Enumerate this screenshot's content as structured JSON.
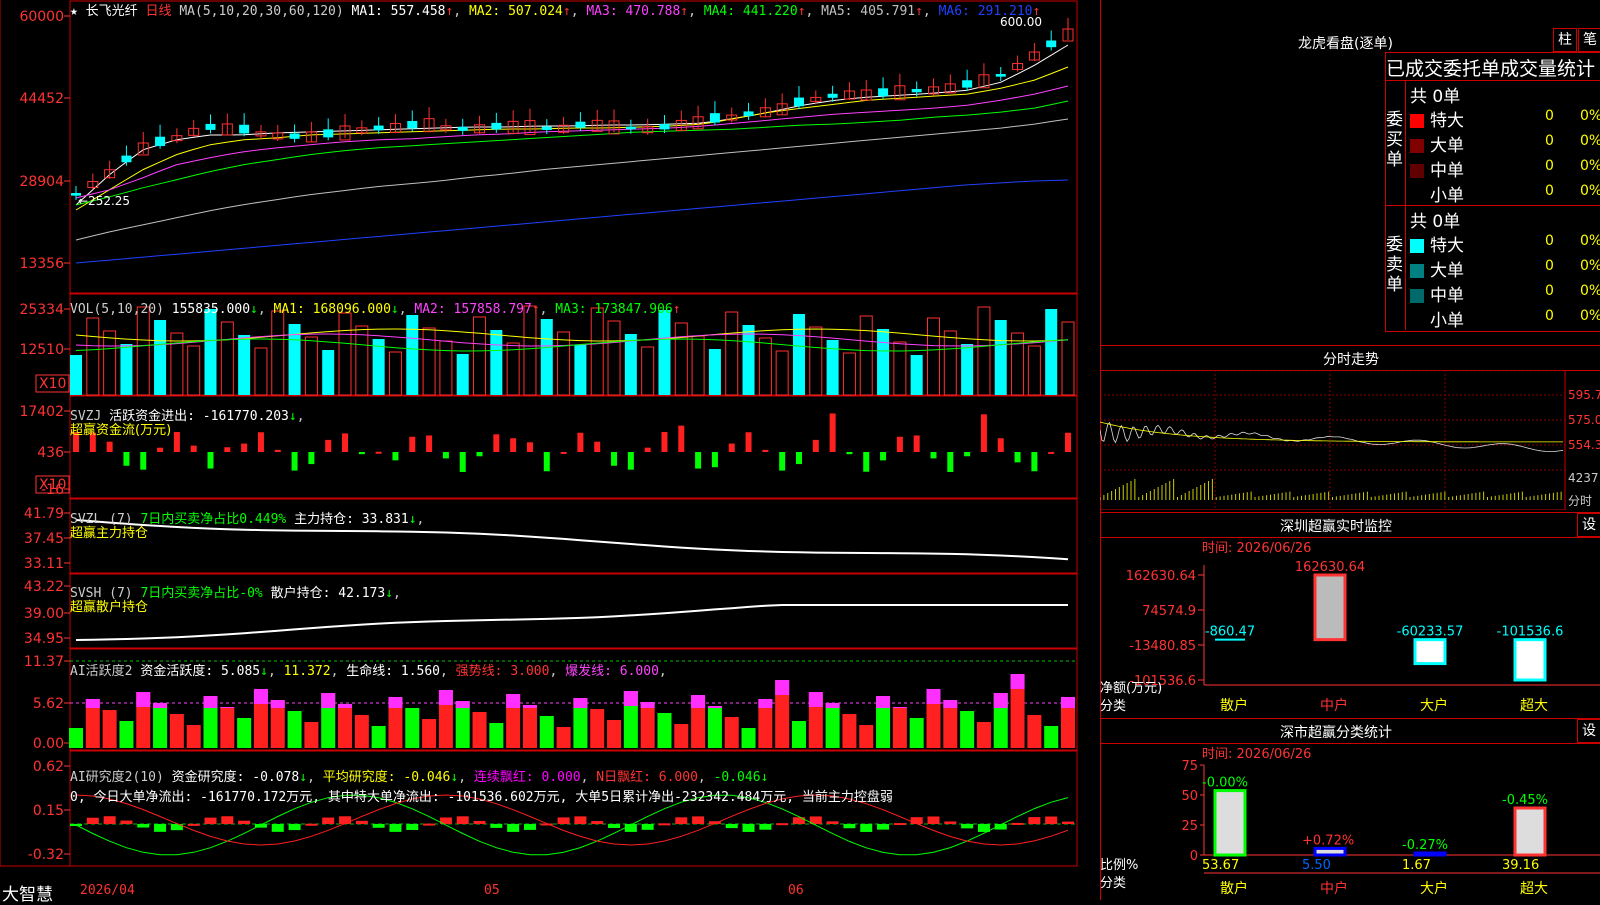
{
  "app": {
    "brand": "大智慧"
  },
  "stock": {
    "name": "长飞光纤",
    "period": "日线"
  },
  "main_panel": {
    "yticks": [
      "60000",
      "44452",
      "28904",
      "13356"
    ],
    "ma_prefix": "MA(5,10,20,30,60,120)",
    "ma": [
      {
        "label": "MA1: 557.458",
        "arrow": "↑",
        "color": "#ffffff"
      },
      {
        "label": "MA2: 507.024",
        "arrow": "↑",
        "color": "#ffff00"
      },
      {
        "label": "MA3: 470.788",
        "arrow": "↑",
        "color": "#ff40ff"
      },
      {
        "label": "MA4: 441.220",
        "arrow": "↑",
        "color": "#00ff00"
      },
      {
        "label": "MA5: 405.791",
        "arrow": "↑",
        "color": "#c0c0c0"
      },
      {
        "label": "MA6: 291.210",
        "arrow": "↑",
        "color": "#2040ff"
      }
    ],
    "high_label": "600.00",
    "low_label": "←252.25"
  },
  "vol_panel": {
    "title": "VOL(5,10,20)",
    "val": "155835.000",
    "val_arrow": "↓",
    "ma1": "MA1: 168096.000",
    "ma1_arrow": "↓",
    "ma2": "MA2: 157858.797",
    "ma2_arrow": "↑",
    "ma3": "MA3: 173847.906",
    "ma3_arrow": "↑",
    "yticks": [
      "25334",
      "12510"
    ],
    "unit": "X10"
  },
  "svzj": {
    "title": "SVZJ",
    "desc": "活跃资金进出: -161770.203",
    "desc_arrow": "↓",
    "subtitle": "超赢资金流(万元)",
    "yticks": [
      "17402",
      "436",
      "-16"
    ],
    "unit": "X10"
  },
  "svzl": {
    "title": "SVZL (7)",
    "desc": "7日内买卖净占比0.449%",
    "desc2": "主力持仓: 33.831",
    "arrow": "↓",
    "subtitle": "超赢主力持仓",
    "yticks": [
      "41.79",
      "37.45",
      "33.11"
    ]
  },
  "svsh": {
    "title": "SVSH (7)",
    "desc": "7日内买卖净占比-0%",
    "desc2": "散户持仓: 42.173",
    "arrow": "↓",
    "subtitle": "超赢散户持仓",
    "yticks": [
      "43.22",
      "39.00",
      "34.95"
    ]
  },
  "ai1": {
    "title": "AI活跃度2",
    "v1": "资金活跃度: 5.085",
    "v1_arrow": "↓",
    "v2": "11.372",
    "v3": "生命线: 1.560",
    "v4": "强势线: 3.000",
    "v5": "爆发线: 6.000",
    "yticks": [
      "11.37",
      "5.62",
      "0.00"
    ]
  },
  "ai2": {
    "title": "AI研究度2(10)",
    "v1": "资金研究度: -0.078",
    "v2": "平均研究度: -0.046",
    "v3": "连续飘红: 0.000",
    "v4": "N日飘红: 6.000",
    "v5": "-0.046",
    "arrow": "↓",
    "line2": "0, 今日大单净流出: -161770.172万元, 其中特大单净流出: -101536.602万元, 大单5日累计净出-232342.484万元, 当前主力控盘弱",
    "yticks": [
      "0.62",
      "0.15",
      "-0.32"
    ]
  },
  "xaxis": {
    "labels": [
      "2026/04",
      "05",
      "06"
    ]
  },
  "right": {
    "lhb_title": "龙虎看盘(逐单)",
    "btn1": "柱",
    "btn2": "笔",
    "header": "已成交委托单成交量统计",
    "buy": {
      "side_label": "委买单",
      "count": "共 0单",
      "rows": [
        {
          "label": "特大",
          "v": "0",
          "p": "0%",
          "color": "#ff0000"
        },
        {
          "label": "大单",
          "v": "0",
          "p": "0%",
          "color": "#800000"
        },
        {
          "label": "中单",
          "v": "0",
          "p": "0%",
          "color": "#600000"
        },
        {
          "label": "小单",
          "v": "0",
          "p": "0%",
          "color": ""
        }
      ]
    },
    "sell": {
      "side_label": "委卖单",
      "count": "共 0单",
      "rows": [
        {
          "label": "特大",
          "v": "0",
          "p": "0%",
          "color": "#00ffff"
        },
        {
          "label": "大单",
          "v": "0",
          "p": "0%",
          "color": "#008080"
        },
        {
          "label": "中单",
          "v": "0",
          "p": "0%",
          "color": "#006a6a"
        },
        {
          "label": "小单",
          "v": "0",
          "p": "0%",
          "color": ""
        }
      ]
    },
    "fenshi": {
      "title": "分时走势",
      "yticks": [
        "595.7",
        "575.0",
        "554.3",
        "4237"
      ],
      "unit": "分时"
    },
    "monitor": {
      "title": "深圳超赢实时监控",
      "set_btn": "设",
      "time": "时间: 2026/06/26",
      "yticks": [
        "162630.64",
        "74574.9",
        "-13480.85",
        "-101536.6"
      ],
      "yaxis_label": "净额(万元)",
      "xaxis_label": "分类",
      "categories": [
        "散户",
        "中户",
        "大户",
        "超大"
      ],
      "bar_labels": [
        "-860.47",
        "162630.64",
        "-60233.57",
        "-101536.6"
      ]
    },
    "classify": {
      "title": "深市超赢分类统计",
      "set_btn": "设",
      "time": "时间: 2026/06/26",
      "yticks": [
        "75",
        "50",
        "25",
        "0"
      ],
      "yaxis_label": "比例%",
      "xaxis_label": "分类",
      "categories": [
        "散户",
        "中户",
        "大户",
        "超大"
      ],
      "values": [
        "53.67",
        "5.50",
        "1.67",
        "39.16"
      ],
      "changes": [
        "-0.00%",
        "+0.72%",
        "-0.27%",
        "-0.45%"
      ]
    }
  },
  "chart_data": [
    {
      "type": "candlestick",
      "title": "长飞光纤 日线",
      "ylim": [
        252.25,
        600.0
      ],
      "high": 600.0,
      "low": 252.25,
      "ma": {
        "MA1": 557.458,
        "MA2": 507.024,
        "MA3": 470.788,
        "MA4": 441.22,
        "MA5": 405.791,
        "MA6": 291.21
      }
    },
    {
      "type": "bar",
      "title": "VOL(5,10,20)",
      "last": 155835.0,
      "ma": {
        "MA1": 168096.0,
        "MA2": 157858.797,
        "MA3": 173847.906
      }
    },
    {
      "type": "bar",
      "title": "深圳超赢实时监控",
      "categories": [
        "散户",
        "中户",
        "大户",
        "超大"
      ],
      "values": [
        -860.47,
        162630.64,
        -60233.57,
        -101536.6
      ],
      "ylabel": "净额(万元)",
      "xlabel": "分类"
    },
    {
      "type": "bar",
      "title": "深市超赢分类统计",
      "categories": [
        "散户",
        "中户",
        "大户",
        "超大"
      ],
      "values": [
        53.67,
        5.5,
        1.67,
        39.16
      ],
      "ylim": [
        0,
        75
      ],
      "ylabel": "比例%",
      "xlabel": "分类"
    }
  ]
}
